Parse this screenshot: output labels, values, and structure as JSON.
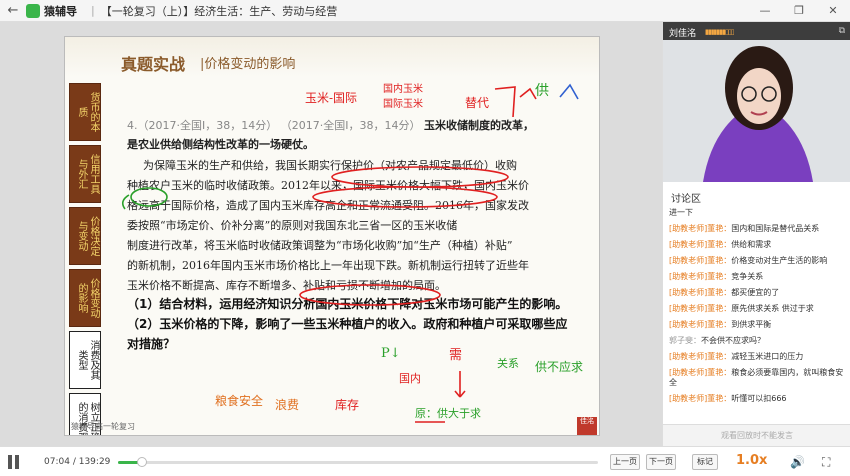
{
  "titlebar": {
    "back": "←",
    "app_name": "猿辅导",
    "course_title": "【一轮复习（上）】经济生活：生产、劳动与经营",
    "minimize": "—",
    "restore": "❐",
    "close": "✕"
  },
  "slide": {
    "title": "真题实战",
    "subtitle": "|价格变动的影响",
    "sidenav": [
      {
        "label": "货币的本质"
      },
      {
        "label": "信用工具与外汇"
      },
      {
        "label": "价格决定与变动"
      },
      {
        "label": "价格变动的影响"
      },
      {
        "label": "消费及其类型"
      },
      {
        "label": "树立正确的消费观"
      }
    ],
    "question_number": "4.（2017·全国Ⅰ，38，14分）",
    "question_number_2": "（2017·全国Ⅰ，38，14分）",
    "question_lead": "玉米收储制度的改革，",
    "lines": [
      "是农业供给侧结构性改革的一场硬仗。",
      "为保障玉米的生产和供给，我国长期实行保护价（对农产品规定最低价）收购",
      "种植农户玉米的临时收储政策。2012年以来，国际玉米价格大幅下跌，国内玉米价",
      "格远高于国际价格，造成了国内玉米库存高企和正常流通受阻。2016年，国家发改",
      "委按照“市场定价、价补分离”的原则对我国东北三省一区的玉米收储",
      "制度进行改革，将玉米临时收储政策调整为“市场化收购”加“生产（种植）补贴”",
      "的新机制，2016年国内玉米市场价格比上一年出现下跌。新机制运行扭转了近些年",
      "玉米价格不断提高、库存不断增多、补贴和亏损不断增加的局面。"
    ],
    "questions": [
      "（1）结合材料，运用经济知识分析国内玉米价格下降对玉米市场可能产生的影响。",
      "（2）玉米价格的下降，影响了一些玉米种植户的收入。政府和种植户可采取哪些应",
      "对措施？"
    ],
    "annotations": {
      "a1": "玉米-国际",
      "a2": "国内玉米",
      "a3": "国际玉米",
      "a4": "替代",
      "a5": "供",
      "a6": "P↓",
      "a7": "需",
      "a8": "关系",
      "a9": "供不应求",
      "a10": "国内",
      "a11": "粮食安全",
      "a12": "浪费",
      "a13": "库存",
      "a14": "原：供大于求"
    },
    "footer_note": "猿辅导高一轮复习",
    "stamp": "佳洺"
  },
  "side": {
    "teacher_name": "刘佳洺",
    "volume_bars": "▮▮▮▮▮▮▮▯▯▯",
    "camera": "⧉",
    "chat_label": "讨论区",
    "messages": [
      {
        "who": "",
        "text": "进一下"
      },
      {
        "who": "[助教老师]董艳：",
        "text": "国内和国际是替代品关系"
      },
      {
        "who": "[助教老师]董艳：",
        "text": "供给和需求"
      },
      {
        "who": "[助教老师]董艳：",
        "text": "价格变动对生产生活的影响"
      },
      {
        "who": "[助教老师]董艳：",
        "text": "竞争关系"
      },
      {
        "who": "[助教老师]董艳：",
        "text": "都买便宜的了"
      },
      {
        "who": "[助教老师]董艳：",
        "text": "原先供求关系 供过于求"
      },
      {
        "who": "[助教老师]董艳：",
        "text": "到供求平衡"
      },
      {
        "who": "郭子斐：",
        "text": "不会供不应求吗？"
      },
      {
        "who": "[助教老师]董艳：",
        "text": "减轻玉米进口的压力"
      },
      {
        "who": "[助教老师]董艳：",
        "text": "粮食必须要靠国内，就叫粮食安全"
      },
      {
        "who": "[助教老师]董艳：",
        "text": "听懂可以扣666"
      }
    ],
    "input_placeholder": "观看回放时不能发言"
  },
  "controls": {
    "current_time": "07:04",
    "total_time": "139:29",
    "time_sep": "/",
    "progress": 0.0507,
    "prev_page": "上一页",
    "next_page": "下一页",
    "bookmark": "标记",
    "speed": "1.0x",
    "volume_icon": "🔊",
    "fullscreen_icon": "⛶"
  }
}
